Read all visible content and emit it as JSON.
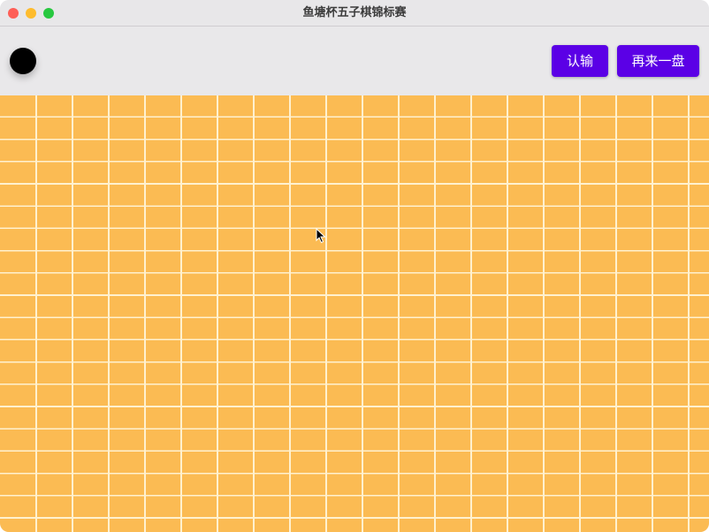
{
  "window": {
    "title": "鱼塘杯五子棋锦标赛"
  },
  "toolbar": {
    "current_player": "black",
    "resign_label": "认输",
    "restart_label": "再来一盘"
  },
  "board": {
    "columns": 20,
    "rows": 20,
    "color": "#fbbb53",
    "line_color": "#fff1cf"
  },
  "colors": {
    "button": "#5b00e6"
  }
}
